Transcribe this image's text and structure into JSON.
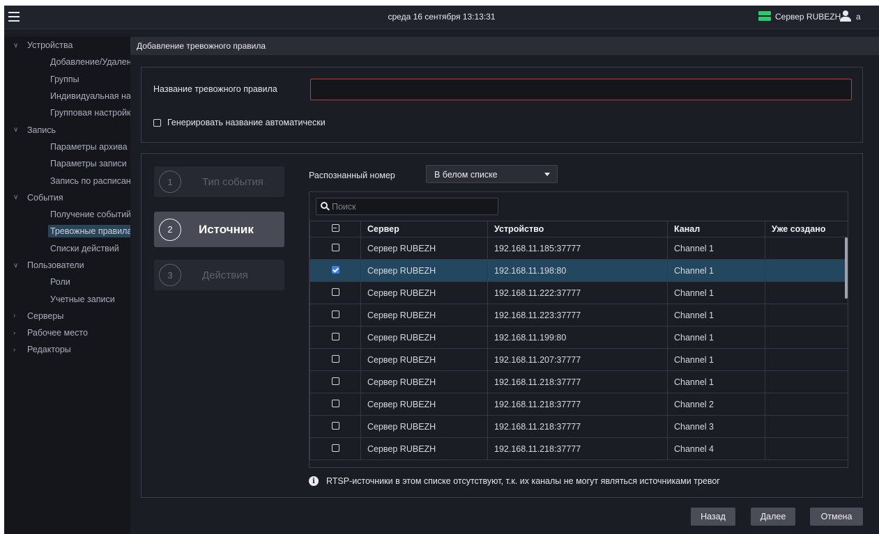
{
  "topbar": {
    "clock": "среда 16 сентября 13:13:31",
    "server": "Сервер RUBEZH",
    "user": "a",
    "server_icon_color": "#2fc86a"
  },
  "sidebar": {
    "items": [
      {
        "label": "Устройства",
        "type": "group",
        "expanded": true
      },
      {
        "label": "Добавление/Удаление",
        "type": "child"
      },
      {
        "label": "Группы",
        "type": "child"
      },
      {
        "label": "Индивидуальная настройка",
        "type": "child"
      },
      {
        "label": "Групповая настройка",
        "type": "child"
      },
      {
        "label": "Запись",
        "type": "group",
        "expanded": true
      },
      {
        "label": "Параметры архива",
        "type": "child"
      },
      {
        "label": "Параметры записи",
        "type": "child"
      },
      {
        "label": "Запись по расписанию",
        "type": "child"
      },
      {
        "label": "События",
        "type": "group",
        "expanded": true
      },
      {
        "label": "Получение событий",
        "type": "child"
      },
      {
        "label": "Тревожные правила",
        "type": "child",
        "selected": true
      },
      {
        "label": "Списки действий",
        "type": "child"
      },
      {
        "label": "Пользователи",
        "type": "group",
        "expanded": true
      },
      {
        "label": "Роли",
        "type": "child"
      },
      {
        "label": "Учетные записи",
        "type": "child"
      },
      {
        "label": "Серверы",
        "type": "group",
        "expanded": false
      },
      {
        "label": "Рабочее место",
        "type": "group",
        "expanded": false
      },
      {
        "label": "Редакторы",
        "type": "group",
        "expanded": false
      }
    ]
  },
  "page": {
    "title": "Добавление тревожного правила"
  },
  "form": {
    "rule_name_label": "Название тревожного правила",
    "rule_name_value": "",
    "auto_name_label": "Генерировать название автоматически"
  },
  "steps": [
    {
      "num": "1",
      "label": "Тип события"
    },
    {
      "num": "2",
      "label": "Источник"
    },
    {
      "num": "3",
      "label": "Действия"
    }
  ],
  "filter": {
    "label": "Распознанный номер",
    "selected": "В белом списке"
  },
  "search": {
    "placeholder": "Поиск"
  },
  "table": {
    "headers": [
      "Сервер",
      "Устройство",
      "Канал",
      "Уже создано"
    ],
    "rows": [
      {
        "server": "Сервер RUBEZH",
        "device": "192.168.11.185:37777",
        "channel": "Channel 1",
        "created": "",
        "checked": false
      },
      {
        "server": "Сервер RUBEZH",
        "device": "192.168.11.198:80",
        "channel": "Channel 1",
        "created": "",
        "checked": true
      },
      {
        "server": "Сервер RUBEZH",
        "device": "192.168.11.222:37777",
        "channel": "Channel 1",
        "created": "",
        "checked": false
      },
      {
        "server": "Сервер RUBEZH",
        "device": "192.168.11.223:37777",
        "channel": "Channel 1",
        "created": "",
        "checked": false
      },
      {
        "server": "Сервер RUBEZH",
        "device": "192.168.11.199:80",
        "channel": "Channel 1",
        "created": "",
        "checked": false
      },
      {
        "server": "Сервер RUBEZH",
        "device": "192.168.11.207:37777",
        "channel": "Channel 1",
        "created": "",
        "checked": false
      },
      {
        "server": "Сервер RUBEZH",
        "device": "192.168.11.218:37777",
        "channel": "Channel 1",
        "created": "",
        "checked": false
      },
      {
        "server": "Сервер RUBEZH",
        "device": "192.168.11.218:37777",
        "channel": "Channel 2",
        "created": "",
        "checked": false
      },
      {
        "server": "Сервер RUBEZH",
        "device": "192.168.11.218:37777",
        "channel": "Channel 3",
        "created": "",
        "checked": false
      },
      {
        "server": "Сервер RUBEZH",
        "device": "192.168.11.218:37777",
        "channel": "Channel 4",
        "created": "",
        "checked": false
      }
    ]
  },
  "info": "RTSP-источники в этом списке отсутствуют, т.к. их каналы не могут являться источниками тревог",
  "buttons": {
    "back": "Назад",
    "next": "Далее",
    "cancel": "Отмена"
  },
  "colors": {
    "selected_row": "#22475e",
    "error_border": "#c43a3a",
    "checkbox_checked": "#3f7fe0"
  }
}
